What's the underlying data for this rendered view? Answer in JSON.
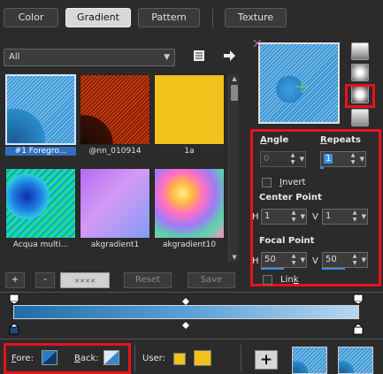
{
  "tabs": [
    {
      "label": "Color"
    },
    {
      "label": "Gradient",
      "active": true
    },
    {
      "label": "Pattern"
    },
    {
      "label": "Texture"
    }
  ],
  "filter": {
    "value": "All"
  },
  "thumbnails": [
    {
      "label": "#1 Foregro...",
      "selected": true
    },
    {
      "label": "@nn_010914"
    },
    {
      "label": "1a"
    },
    {
      "label": "Acqua multi..."
    },
    {
      "label": "akgradient1"
    },
    {
      "label": "akgradient10"
    }
  ],
  "buttons": {
    "add": "+",
    "remove": "-",
    "reset": "Reset",
    "save": "Save"
  },
  "settings": {
    "angle_label": "Angle",
    "angle_value": "0",
    "repeats_label": "Repeats",
    "repeats_value": "1",
    "invert_label": "Invert",
    "center_label": "Center Point",
    "center_h_label": "H",
    "center_h_value": "1",
    "center_v_label": "V",
    "center_v_value": "1",
    "focal_label": "Focal Point",
    "focal_h_label": "H",
    "focal_h_value": "50",
    "focal_v_label": "V",
    "focal_v_value": "50",
    "link_label": "Link"
  },
  "bottom": {
    "fore_label": "Fore:",
    "back_label": "Back:",
    "user_label": "User:"
  },
  "colors": {
    "accent_red": "#e8121c",
    "gradient_light": "#b6d6f0",
    "gradient_dark": "#1f6ea8",
    "user_swatch": "#f1c21b"
  },
  "icons": [
    "palette-book-icon",
    "arrow-right-icon",
    "linear-style-icon",
    "rectangular-style-icon",
    "sunburst-style-icon",
    "radial-style-icon",
    "plus-icon"
  ]
}
